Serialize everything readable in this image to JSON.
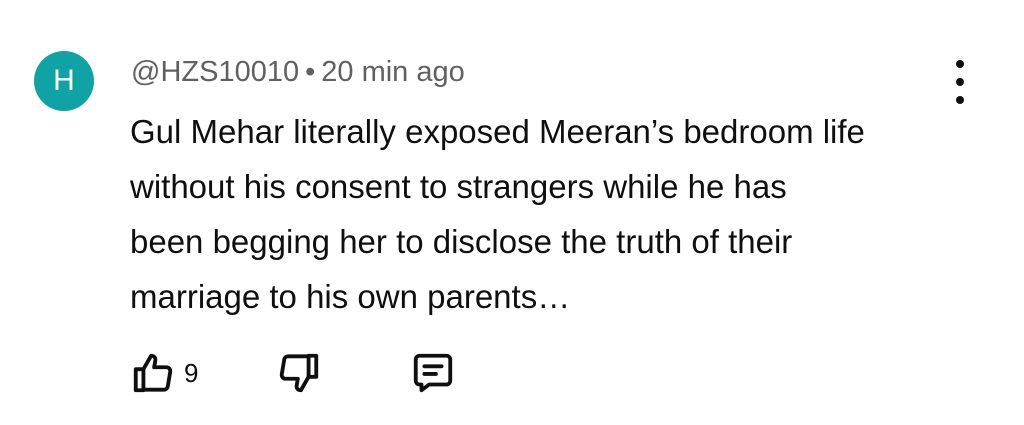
{
  "comment": {
    "avatar_letter": "H",
    "avatar_color": "#0fa3a6",
    "author": "@HZS10010",
    "separator": "•",
    "timestamp": "20 min ago",
    "text_lines": [
      "Gul Mehar literally exposed Meeran’s bedroom life",
      "without his consent to strangers while he has",
      "been begging her to disclose the truth of their",
      "marriage to his own parents…"
    ],
    "like_count": "9",
    "icons": {
      "like": "thumbs-up-icon",
      "dislike": "thumbs-down-icon",
      "reply": "reply-comment-icon",
      "menu": "more-vertical-icon"
    }
  }
}
